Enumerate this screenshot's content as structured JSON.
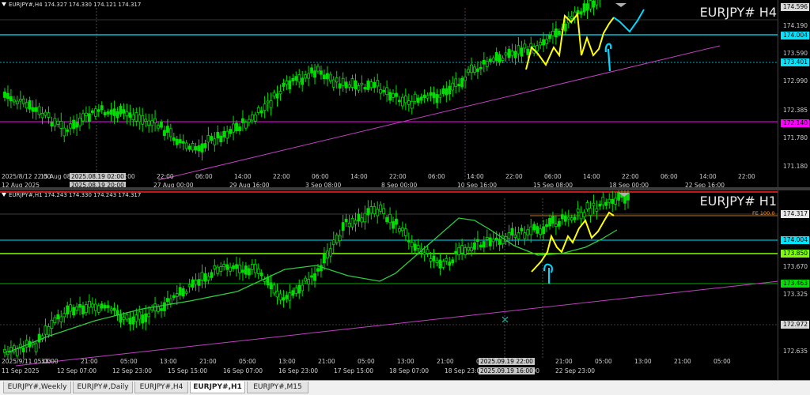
{
  "charts": {
    "h4": {
      "header": "EURJPY#,H4  174.327 174.330 174.121 174.317",
      "title": "EURJPY# H4",
      "prices": [
        {
          "text": "174.596",
          "style": "box",
          "color": "#d8d8d8"
        },
        {
          "text": "174.190",
          "style": "plain",
          "color": ""
        },
        {
          "text": "174.004",
          "style": "box",
          "color": "#00e5ff"
        },
        {
          "text": "173.590",
          "style": "plain",
          "color": ""
        },
        {
          "text": "173.401",
          "style": "box",
          "color": "#00e5ff"
        },
        {
          "text": "172.990",
          "style": "plain",
          "color": ""
        },
        {
          "text": "172.385",
          "style": "plain",
          "color": ""
        },
        {
          "text": "172.140",
          "style": "box",
          "color": "#ff00ff"
        },
        {
          "text": "171.780",
          "style": "plain",
          "color": ""
        },
        {
          "text": "171.180",
          "style": "plain",
          "color": ""
        }
      ],
      "times": [
        "2025/8/12 22:00",
        "15 Aug 08:00",
        "06:00",
        "14:00",
        "22:00",
        "06:00",
        "14:00",
        "22:00",
        "06:00",
        "14:00",
        "22:00",
        "06:00",
        "14:00",
        "22:00",
        "06:00",
        "14:00",
        "22:00",
        "06:00",
        "14:00",
        "22:00"
      ],
      "times2": [
        "12 Aug 2025",
        "22 Aug 08:00",
        "27 Aug 00:00",
        "29 Aug 16:00",
        "3 Sep 08:00",
        "8 Sep 00:00",
        "10 Sep 16:00",
        "15 Sep 08:00",
        "18 Sep 00:00",
        "22 Sep 16:00"
      ],
      "crosshair_times": [
        "2025.08.19 02:00",
        "2025.08.19 20:00"
      ]
    },
    "h1": {
      "header": "EURJPY#,H1  174.243 174.330 174.243 174.317",
      "title": "EURJPY# H1",
      "fe_label": "FE 100.0",
      "prices": [
        {
          "text": "174.317",
          "style": "box",
          "color": "#e8e8e8"
        },
        {
          "text": "174.004",
          "style": "box",
          "color": "#00e5ff"
        },
        {
          "text": "173.850",
          "style": "box",
          "color": "#7cff00"
        },
        {
          "text": "173.670",
          "style": "plain",
          "color": ""
        },
        {
          "text": "173.463",
          "style": "box",
          "color": "#00e000"
        },
        {
          "text": "173.325",
          "style": "plain",
          "color": ""
        },
        {
          "text": "172.972",
          "style": "box",
          "color": "#d8d8d8"
        },
        {
          "text": "172.635",
          "style": "plain",
          "color": ""
        }
      ],
      "times": [
        "2025/9/11 05:00",
        "13:00",
        "21:00",
        "05:00",
        "13:00",
        "21:00",
        "05:00",
        "13:00",
        "21:00",
        "05:00",
        "13:00",
        "21:00",
        "05:00",
        "13:00",
        "21:00",
        "05:00",
        "13:00",
        "21:00",
        "05:00"
      ],
      "times2": [
        "11 Sep 2025",
        "12 Sep 07:00",
        "12 Sep 23:00",
        "15 Sep 15:00",
        "16 Sep 07:00",
        "16 Sep 23:00",
        "17 Sep 15:00",
        "18 Sep 07:00",
        "18 Sep 23:00",
        "22 Sep 07:00",
        "22 Sep 23:00"
      ],
      "crosshair_times": [
        "2025.09.19 22:00",
        "2025.09.19 16:00"
      ]
    }
  },
  "tabs": [
    {
      "label": "EURJPY#,Weekly",
      "active": false
    },
    {
      "label": "EURJPY#,Daily",
      "active": false
    },
    {
      "label": "EURJPY#,H4",
      "active": false
    },
    {
      "label": "EURJPY#,H1",
      "active": true
    },
    {
      "label": "EURJPY#,M15",
      "active": false
    }
  ],
  "colors": {
    "candle": "#00e000",
    "ma": "#2ecc40",
    "trendline": "#c040c0",
    "annotation_yellow": "#ffff00",
    "annotation_cyan": "#00d8ff",
    "hline_cyan": "#00e5ff",
    "hline_magenta": "#ff00ff",
    "hline_green": "#7cff00",
    "hline_red": "#ff2020"
  }
}
